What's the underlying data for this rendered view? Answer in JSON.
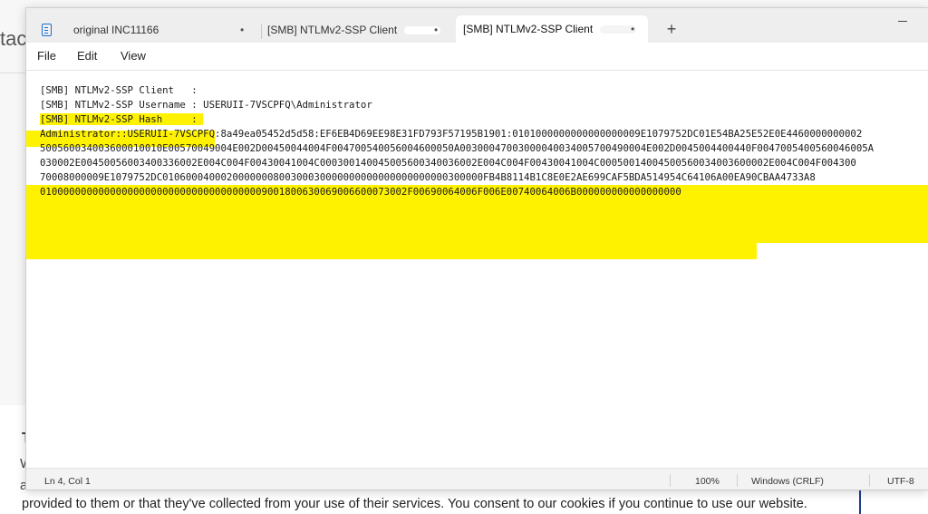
{
  "background": {
    "fragment": "tac",
    "heading": "T",
    "line_w": "W",
    "line_a": "a",
    "cookie_text": "provided to them or that they've collected from your use of their services. You consent to our cookies if you continue to use our website."
  },
  "tabs": [
    {
      "label": "original INC11166",
      "dot": "•"
    },
    {
      "label": "[SMB] NTLMv2-SSP Client",
      "dot": "•"
    },
    {
      "label": "[SMB] NTLMv2-SSP Client",
      "dot": "•"
    }
  ],
  "new_tab": "+",
  "menu": {
    "file": "File",
    "edit": "Edit",
    "view": "View"
  },
  "editor": {
    "lines": [
      "[SMB] NTLMv2-SSP Client   : ",
      "[SMB] NTLMv2-SSP Username : USERUII-7VSCPFQ\\Administrator",
      "[SMB] NTLMv2-SSP Hash     : ",
      "Administrator::USERUII-7VSCPFQ:8a49ea05452d5d58:EF6EB4D69EE98E31FD793F57195B1901:0101000000000000000009E1079752DC01E54BA25E52E0E4460000000002",
      "500560034003600010010E00570049004E002D00450044004F004700540056004600050A00300047003000040034005700490004E002D0045004400440F0047005400560046005A",
      "030002E00450056003400336002E004C004F00430041004C000300140045005600340036002E004C004F00430041004C00050014004500560034003600002E004C004F004300",
      "70008000009E1079752DC0106000400020000000800300030000000000000000000000300000FB4B8114B1C8E0E2AE699CAF5BDA514954C64106A00EA90CBAA4733A8",
      "010000000000000000000000000000000000009001800630069006600073002F00690064006F006E00740064006B000000000000000000"
    ]
  },
  "status": {
    "position": "Ln 4, Col 1",
    "zoom": "100%",
    "line_ending": "Windows (CRLF)",
    "encoding": "UTF-8"
  },
  "colors": {
    "highlight": "#fff200",
    "tab_icon": "#1b6fd6"
  }
}
